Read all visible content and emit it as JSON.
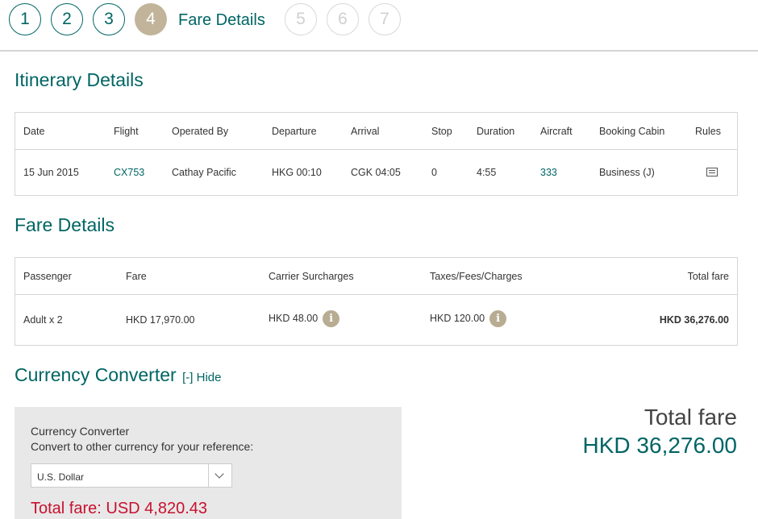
{
  "steps": {
    "s1": "1",
    "s2": "2",
    "s3": "3",
    "s4": "4",
    "s5": "5",
    "s6": "6",
    "s7": "7",
    "active_label": "Fare Details"
  },
  "itinerary": {
    "title": "Itinerary Details",
    "headers": {
      "date": "Date",
      "flight": "Flight",
      "operated_by": "Operated By",
      "departure": "Departure",
      "arrival": "Arrival",
      "stop": "Stop",
      "duration": "Duration",
      "aircraft": "Aircraft",
      "booking_cabin": "Booking Cabin",
      "rules": "Rules"
    },
    "row": {
      "date": "15 Jun 2015",
      "flight": "CX753",
      "operated_by": "Cathay Pacific",
      "departure": "HKG 00:10",
      "arrival": "CGK 04:05",
      "stop": "0",
      "duration": "4:55",
      "aircraft": "333",
      "booking_cabin": "Business (J)",
      "rules_icon": "document-icon"
    }
  },
  "fare": {
    "title": "Fare Details",
    "headers": {
      "passenger": "Passenger",
      "fare": "Fare",
      "carrier_surcharges": "Carrier Surcharges",
      "taxes": "Taxes/Fees/Charges",
      "total_fare": "Total fare"
    },
    "row": {
      "passenger": "Adult x 2",
      "fare": "HKD 17,970.00",
      "carrier_surcharges": "HKD 48.00",
      "taxes": "HKD 120.00",
      "total_fare": "HKD 36,276.00"
    },
    "info_glyph": "i"
  },
  "converter": {
    "title": "Currency Converter",
    "toggle": "[-] Hide",
    "box_title": "Currency Converter",
    "box_subtitle": "Convert to other currency for your reference:",
    "selected_currency": "U.S. Dollar",
    "converted_total": "Total fare: USD 4,820.43"
  },
  "summary": {
    "label": "Total fare",
    "amount": "HKD 36,276.00"
  },
  "colors": {
    "teal": "#006564",
    "gold": "#c1b49a",
    "red": "#c8102e",
    "panel": "#e8e8e8"
  }
}
